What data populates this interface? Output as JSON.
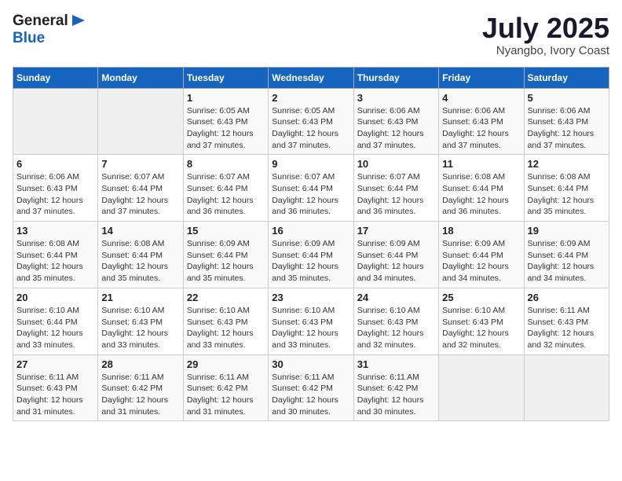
{
  "header": {
    "logo_general": "General",
    "logo_blue": "Blue",
    "month": "July 2025",
    "location": "Nyangbo, Ivory Coast"
  },
  "weekdays": [
    "Sunday",
    "Monday",
    "Tuesday",
    "Wednesday",
    "Thursday",
    "Friday",
    "Saturday"
  ],
  "weeks": [
    [
      {
        "day": "",
        "detail": ""
      },
      {
        "day": "",
        "detail": ""
      },
      {
        "day": "1",
        "detail": "Sunrise: 6:05 AM\nSunset: 6:43 PM\nDaylight: 12 hours and 37 minutes."
      },
      {
        "day": "2",
        "detail": "Sunrise: 6:05 AM\nSunset: 6:43 PM\nDaylight: 12 hours and 37 minutes."
      },
      {
        "day": "3",
        "detail": "Sunrise: 6:06 AM\nSunset: 6:43 PM\nDaylight: 12 hours and 37 minutes."
      },
      {
        "day": "4",
        "detail": "Sunrise: 6:06 AM\nSunset: 6:43 PM\nDaylight: 12 hours and 37 minutes."
      },
      {
        "day": "5",
        "detail": "Sunrise: 6:06 AM\nSunset: 6:43 PM\nDaylight: 12 hours and 37 minutes."
      }
    ],
    [
      {
        "day": "6",
        "detail": "Sunrise: 6:06 AM\nSunset: 6:43 PM\nDaylight: 12 hours and 37 minutes."
      },
      {
        "day": "7",
        "detail": "Sunrise: 6:07 AM\nSunset: 6:44 PM\nDaylight: 12 hours and 37 minutes."
      },
      {
        "day": "8",
        "detail": "Sunrise: 6:07 AM\nSunset: 6:44 PM\nDaylight: 12 hours and 36 minutes."
      },
      {
        "day": "9",
        "detail": "Sunrise: 6:07 AM\nSunset: 6:44 PM\nDaylight: 12 hours and 36 minutes."
      },
      {
        "day": "10",
        "detail": "Sunrise: 6:07 AM\nSunset: 6:44 PM\nDaylight: 12 hours and 36 minutes."
      },
      {
        "day": "11",
        "detail": "Sunrise: 6:08 AM\nSunset: 6:44 PM\nDaylight: 12 hours and 36 minutes."
      },
      {
        "day": "12",
        "detail": "Sunrise: 6:08 AM\nSunset: 6:44 PM\nDaylight: 12 hours and 35 minutes."
      }
    ],
    [
      {
        "day": "13",
        "detail": "Sunrise: 6:08 AM\nSunset: 6:44 PM\nDaylight: 12 hours and 35 minutes."
      },
      {
        "day": "14",
        "detail": "Sunrise: 6:08 AM\nSunset: 6:44 PM\nDaylight: 12 hours and 35 minutes."
      },
      {
        "day": "15",
        "detail": "Sunrise: 6:09 AM\nSunset: 6:44 PM\nDaylight: 12 hours and 35 minutes."
      },
      {
        "day": "16",
        "detail": "Sunrise: 6:09 AM\nSunset: 6:44 PM\nDaylight: 12 hours and 35 minutes."
      },
      {
        "day": "17",
        "detail": "Sunrise: 6:09 AM\nSunset: 6:44 PM\nDaylight: 12 hours and 34 minutes."
      },
      {
        "day": "18",
        "detail": "Sunrise: 6:09 AM\nSunset: 6:44 PM\nDaylight: 12 hours and 34 minutes."
      },
      {
        "day": "19",
        "detail": "Sunrise: 6:09 AM\nSunset: 6:44 PM\nDaylight: 12 hours and 34 minutes."
      }
    ],
    [
      {
        "day": "20",
        "detail": "Sunrise: 6:10 AM\nSunset: 6:44 PM\nDaylight: 12 hours and 33 minutes."
      },
      {
        "day": "21",
        "detail": "Sunrise: 6:10 AM\nSunset: 6:43 PM\nDaylight: 12 hours and 33 minutes."
      },
      {
        "day": "22",
        "detail": "Sunrise: 6:10 AM\nSunset: 6:43 PM\nDaylight: 12 hours and 33 minutes."
      },
      {
        "day": "23",
        "detail": "Sunrise: 6:10 AM\nSunset: 6:43 PM\nDaylight: 12 hours and 33 minutes."
      },
      {
        "day": "24",
        "detail": "Sunrise: 6:10 AM\nSunset: 6:43 PM\nDaylight: 12 hours and 32 minutes."
      },
      {
        "day": "25",
        "detail": "Sunrise: 6:10 AM\nSunset: 6:43 PM\nDaylight: 12 hours and 32 minutes."
      },
      {
        "day": "26",
        "detail": "Sunrise: 6:11 AM\nSunset: 6:43 PM\nDaylight: 12 hours and 32 minutes."
      }
    ],
    [
      {
        "day": "27",
        "detail": "Sunrise: 6:11 AM\nSunset: 6:43 PM\nDaylight: 12 hours and 31 minutes."
      },
      {
        "day": "28",
        "detail": "Sunrise: 6:11 AM\nSunset: 6:42 PM\nDaylight: 12 hours and 31 minutes."
      },
      {
        "day": "29",
        "detail": "Sunrise: 6:11 AM\nSunset: 6:42 PM\nDaylight: 12 hours and 31 minutes."
      },
      {
        "day": "30",
        "detail": "Sunrise: 6:11 AM\nSunset: 6:42 PM\nDaylight: 12 hours and 30 minutes."
      },
      {
        "day": "31",
        "detail": "Sunrise: 6:11 AM\nSunset: 6:42 PM\nDaylight: 12 hours and 30 minutes."
      },
      {
        "day": "",
        "detail": ""
      },
      {
        "day": "",
        "detail": ""
      }
    ]
  ]
}
